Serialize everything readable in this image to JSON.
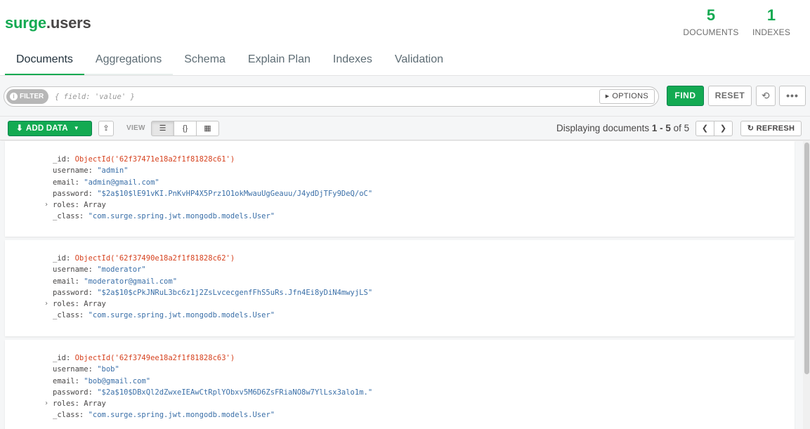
{
  "namespace": {
    "db": "surge",
    "collection": ".users"
  },
  "stats": {
    "documents": {
      "count": "5",
      "label": "DOCUMENTS"
    },
    "indexes": {
      "count": "1",
      "label": "INDEXES"
    }
  },
  "tabs": [
    {
      "label": "Documents",
      "active": true
    },
    {
      "label": "Aggregations",
      "active": false
    },
    {
      "label": "Schema",
      "active": false
    },
    {
      "label": "Explain Plan",
      "active": false
    },
    {
      "label": "Indexes",
      "active": false
    },
    {
      "label": "Validation",
      "active": false
    }
  ],
  "querybar": {
    "filter_label": "FILTER",
    "filter_placeholder": "{ field: 'value' }",
    "options_label": "OPTIONS",
    "find_label": "FIND",
    "reset_label": "RESET",
    "history_icon": "history-icon",
    "more_icon": "ellipsis-icon"
  },
  "toolbar": {
    "add_data_label": "ADD DATA",
    "view_label": "VIEW",
    "view_modes": [
      "list-view-icon",
      "json-view-icon",
      "table-view-icon"
    ],
    "displaying_prefix": "Displaying documents ",
    "range": "1 - 5",
    "of_text": " of ",
    "total": "5",
    "refresh_label": "REFRESH"
  },
  "documents": [
    {
      "_id": "ObjectId('62f37471e18a2f1f81828c61')",
      "username": "\"admin\"",
      "email": "\"admin@gmail.com\"",
      "password": "\"$2a$10$lE91vKI.PnKvHP4X5Prz1O1okMwauUgGeauu/J4ydDjTFy9DeQ/oC\"",
      "roles": "Array",
      "_class": "\"com.surge.spring.jwt.mongodb.models.User\""
    },
    {
      "_id": "ObjectId('62f37490e18a2f1f81828c62')",
      "username": "\"moderator\"",
      "email": "\"moderator@gmail.com\"",
      "password": "\"$2a$10$cPkJNRuL3bc6z1j2ZsLvcecgenfFhS5uRs.Jfn4Ei8yDiN4mwyjLS\"",
      "roles": "Array",
      "_class": "\"com.surge.spring.jwt.mongodb.models.User\""
    },
    {
      "_id": "ObjectId('62f3749ee18a2f1f81828c63')",
      "username": "\"bob\"",
      "email": "\"bob@gmail.com\"",
      "password": "\"$2a$10$DBxQl2dZwxeIEAwCtRplYObxv5M6D6ZsFRiaNO8w7YlLsx3alo1m.\"",
      "roles": "Array",
      "_class": "\"com.surge.spring.jwt.mongodb.models.User\""
    }
  ],
  "field_keys": {
    "id": "_id: ",
    "username": "username: ",
    "email": "email: ",
    "password": "password: ",
    "roles": "roles: ",
    "class": "_class: "
  },
  "colors": {
    "accent": "#13aa52",
    "objectid": "#d6421f",
    "string": "#3a6fa8"
  }
}
